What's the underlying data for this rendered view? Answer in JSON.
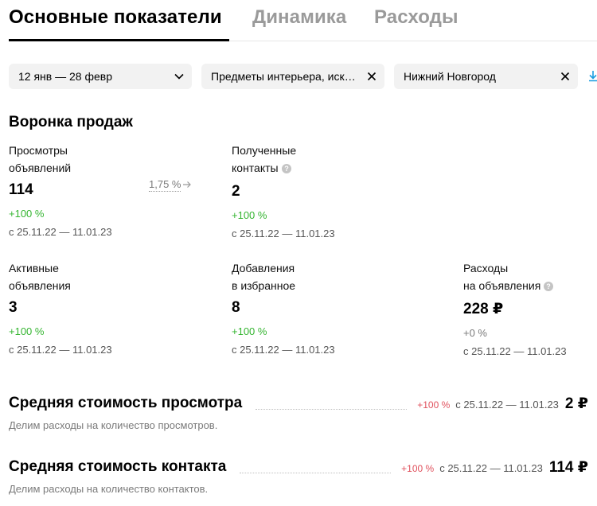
{
  "tabs": [
    {
      "label": "Основные показатели",
      "active": true
    },
    {
      "label": "Динамика",
      "active": false
    },
    {
      "label": "Расходы",
      "active": false
    }
  ],
  "filters": {
    "period": {
      "value": "12 янв — 28 февр",
      "icon": "chevron-down-icon"
    },
    "category": {
      "value": "Предметы интерьера, искусство",
      "icon": "close-icon"
    },
    "region": {
      "value": "Нижний Новгород",
      "icon": "close-icon"
    },
    "download_icon": "download-icon"
  },
  "funnel": {
    "title": "Воронка продаж",
    "conversion": "1,75 %",
    "metrics": {
      "views": {
        "label_1": "Просмотры",
        "label_2": "объявлений",
        "value": "114",
        "delta": "+100 %",
        "period": "с 25.11.22 — 11.01.23"
      },
      "contacts": {
        "label_1": "Полученные",
        "label_2": "контакты",
        "value": "2",
        "delta": "+100 %",
        "period": "с 25.11.22 — 11.01.23"
      },
      "active": {
        "label_1": "Активные",
        "label_2": "объявления",
        "value": "3",
        "delta": "+100 %",
        "period": "с 25.11.22 — 11.01.23"
      },
      "favorites": {
        "label_1": "Добавления",
        "label_2": "в избранное",
        "value": "8",
        "delta": "+100 %",
        "period": "с 25.11.22 — 11.01.23"
      },
      "expenses": {
        "label_1": "Расходы",
        "label_2": "на объявления",
        "value": "228 ₽",
        "delta": "+0 %",
        "period": "с 25.11.22 — 11.01.23"
      }
    }
  },
  "costs": {
    "view": {
      "title": "Средняя стоимость просмотра",
      "delta": "+100 %",
      "period": "с 25.11.22 — 11.01.23",
      "value": "2 ₽",
      "description": "Делим расходы на количество просмотров."
    },
    "contact": {
      "title": "Средняя стоимость контакта",
      "delta": "+100 %",
      "period": "с 25.11.22 — 11.01.23",
      "value": "114 ₽",
      "description": "Делим расходы на количество контактов."
    }
  },
  "colors": {
    "positive": "#35b531",
    "negative": "#e0525e",
    "muted": "#7a7a7a",
    "filter_bg": "#f2f2f2",
    "download": "#1a9de0"
  }
}
